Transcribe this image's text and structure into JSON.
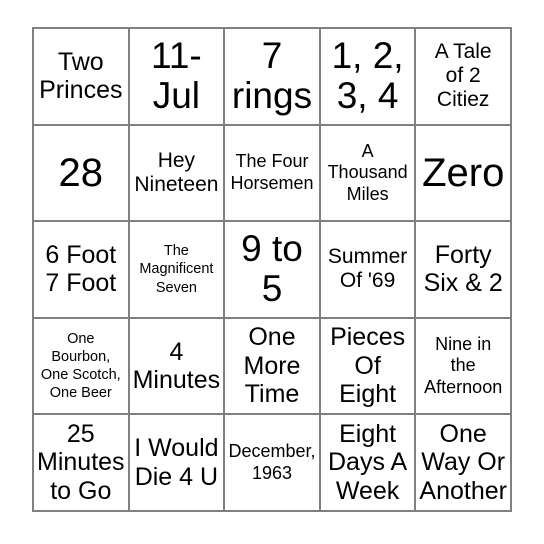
{
  "card": {
    "type": "bingo-card",
    "rows": 5,
    "columns": 5,
    "border_color": "#808080",
    "cell_background": "#ffffff",
    "text_color": "#000000",
    "cells": [
      {
        "text": "Two\nPrinces",
        "size": "md"
      },
      {
        "text": "11-\nJul",
        "size": "xl"
      },
      {
        "text": "7\nrings",
        "size": "xl"
      },
      {
        "text": "1, 2,\n3, 4",
        "size": "xl"
      },
      {
        "text": "A Tale\nof 2\nCitiez",
        "size": "sm"
      },
      {
        "text": "28",
        "size": "xxl"
      },
      {
        "text": "Hey\nNineteen",
        "size": "sm"
      },
      {
        "text": "The Four\nHorsemen",
        "size": "xs"
      },
      {
        "text": "A\nThousand\nMiles",
        "size": "xs"
      },
      {
        "text": "Zero",
        "size": "xxl"
      },
      {
        "text": "6 Foot\n7 Foot",
        "size": "md"
      },
      {
        "text": "The\nMagnificent\nSeven",
        "size": "xxs"
      },
      {
        "text": "9 to\n5",
        "size": "xl"
      },
      {
        "text": "Summer\nOf '69",
        "size": "sm"
      },
      {
        "text": "Forty\nSix & 2",
        "size": "md"
      },
      {
        "text": "One\nBourbon,\nOne Scotch,\nOne Beer",
        "size": "xxs"
      },
      {
        "text": "4\nMinutes",
        "size": "md"
      },
      {
        "text": "One\nMore\nTime",
        "size": "md"
      },
      {
        "text": "Pieces\nOf\nEight",
        "size": "md"
      },
      {
        "text": "Nine in\nthe\nAfternoon",
        "size": "xs"
      },
      {
        "text": "25\nMinutes\nto Go",
        "size": "md"
      },
      {
        "text": "I Would\nDie 4 U",
        "size": "md"
      },
      {
        "text": "December,\n1963",
        "size": "xs"
      },
      {
        "text": "Eight\nDays A\nWeek",
        "size": "md"
      },
      {
        "text": "One\nWay Or\nAnother",
        "size": "md"
      }
    ]
  }
}
